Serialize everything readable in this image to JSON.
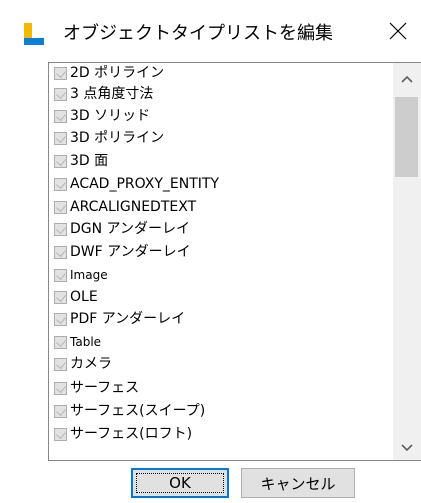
{
  "window": {
    "title": "オブジェクトタイプリストを編集",
    "close_glyph": "✕"
  },
  "list": {
    "items": [
      {
        "label": "2D ポリライン",
        "checked": true
      },
      {
        "label": "3 点角度寸法",
        "checked": true
      },
      {
        "label": "3D ソリッド",
        "checked": true
      },
      {
        "label": "3D ポリライン",
        "checked": true
      },
      {
        "label": "3D 面",
        "checked": true
      },
      {
        "label": "ACAD_PROXY_ENTITY",
        "checked": true
      },
      {
        "label": "ARCALIGNEDTEXT",
        "checked": true
      },
      {
        "label": "DGN アンダーレイ",
        "checked": true
      },
      {
        "label": "DWF アンダーレイ",
        "checked": true
      },
      {
        "label": "Image",
        "checked": true
      },
      {
        "label": "OLE",
        "checked": true
      },
      {
        "label": "PDF アンダーレイ",
        "checked": true
      },
      {
        "label": "Table",
        "checked": true
      },
      {
        "label": "カメラ",
        "checked": true
      },
      {
        "label": "サーフェス",
        "checked": true
      },
      {
        "label": "サーフェス(スイープ)",
        "checked": true
      },
      {
        "label": "サーフェス(ロフト)",
        "checked": true
      }
    ]
  },
  "buttons": {
    "ok": "OK",
    "cancel": "キャンセル"
  },
  "icons": {
    "app": "window-app-icon",
    "close": "close-icon",
    "scroll_up": "chevron-up-icon",
    "scroll_down": "chevron-down-icon"
  },
  "colors": {
    "accent": "#0078d7",
    "icon_yellow": "#f5b800",
    "icon_blue": "#0a7fd8"
  }
}
